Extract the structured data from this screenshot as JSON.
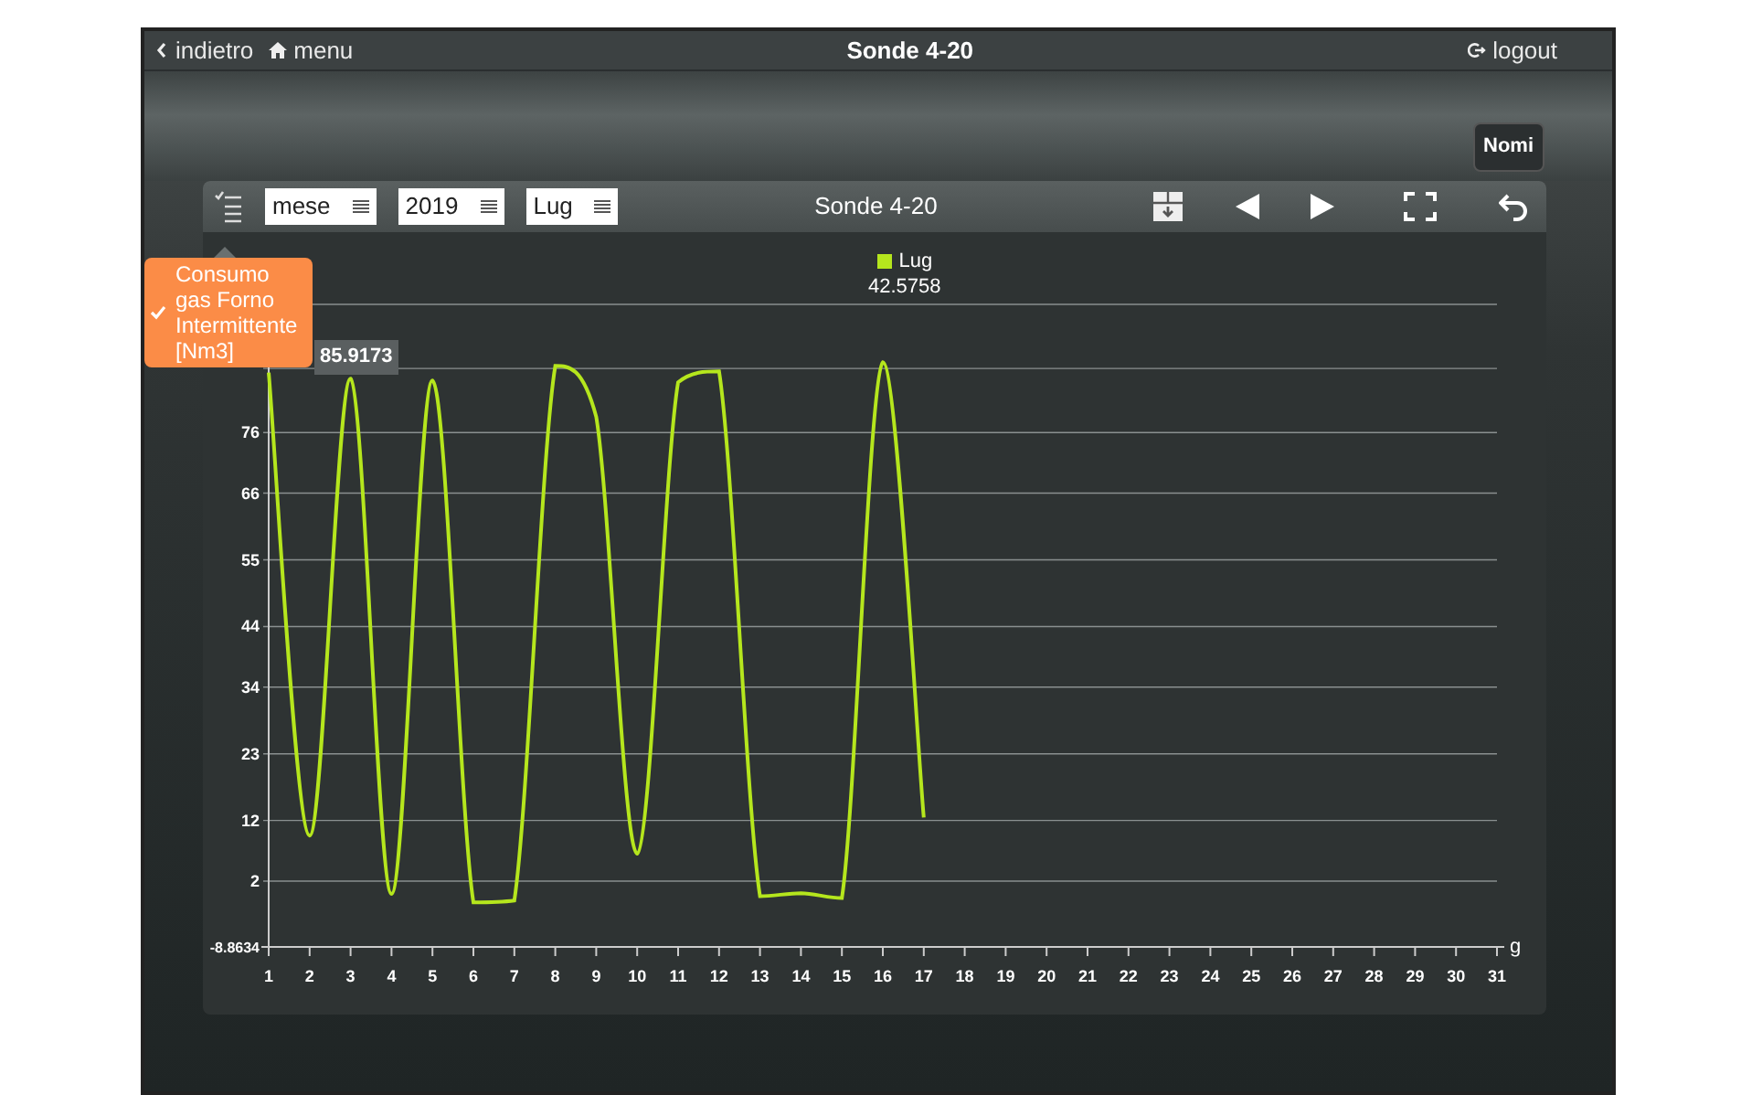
{
  "header": {
    "back": "indietro",
    "menu": "menu",
    "title": "Sonde 4-20",
    "logout": "logout"
  },
  "names_button": "Nomi",
  "toolbar": {
    "selects": [
      {
        "value": "mese"
      },
      {
        "value": "2019"
      },
      {
        "value": "Lug"
      }
    ],
    "title": "Sonde 4-20"
  },
  "series_menu": [
    {
      "label": "Consumo gas Forno Intermittente [Nm3]",
      "checked": true
    }
  ],
  "tooltip": "85.9173",
  "legend": {
    "value": "42.5758"
  },
  "chart": {
    "chart_data": {
      "type": "line",
      "xlabel": "g",
      "grid": true,
      "categories": [
        "1",
        "2",
        "3",
        "4",
        "5",
        "6",
        "7",
        "8",
        "9",
        "10",
        "11",
        "12",
        "13",
        "14",
        "15",
        "16",
        "17",
        "18",
        "19",
        "20",
        "21",
        "22",
        "23",
        "24",
        "25",
        "26",
        "27",
        "28",
        "29",
        "30",
        "31"
      ],
      "series": [
        {
          "name": "Lug",
          "color": "#b5e61d",
          "values": [
            85.9,
            9.5,
            84.9,
            -0.1,
            84.6,
            -1.5,
            -1.2,
            87,
            78.6,
            6.5,
            84.3,
            86.1,
            -0.5,
            0,
            -0.8,
            87.6,
            12.5,
            null,
            null,
            null,
            null,
            null,
            null,
            null,
            null,
            null,
            null,
            null,
            null,
            null,
            null
          ]
        }
      ],
      "ylim": [
        -8.8634,
        97
      ],
      "yticks": [
        {
          "value": -8.8634,
          "label": "-8.8634"
        },
        2,
        12,
        23,
        34,
        44,
        55,
        66,
        76
      ]
    }
  }
}
